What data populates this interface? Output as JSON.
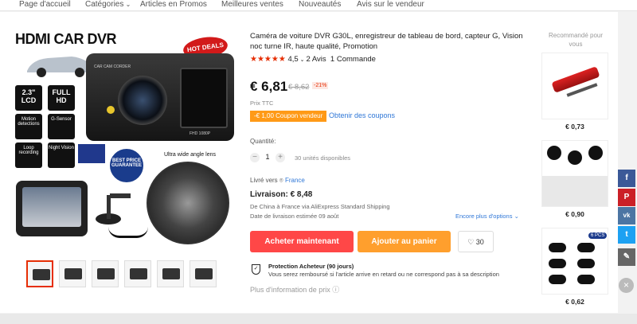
{
  "nav": {
    "items": [
      "Page d'accueil",
      "Catégories",
      "Articles en Promos",
      "Meilleures ventes",
      "Nouveautés",
      "Avis sur le vendeur"
    ],
    "categories_chevron": "chevron-down-icon"
  },
  "gallery": {
    "image_text": {
      "title": "HDMI CAR DVR",
      "hot_deals": "HOT DEALS",
      "lcd": "2.3\" LCD",
      "full_hd": "FULL HD",
      "motion": "Motion detections",
      "gsensor": "G-Sensor",
      "loop": "Loop recording",
      "night": "Night Vision",
      "best_price": "BEST PRICE GUARANTEE",
      "wide_angle": "Ultra wide angle lens",
      "fhd": "FHD 1080P",
      "corder": "CAR CAM CORDER"
    },
    "thumb_count": 6
  },
  "product": {
    "title": "Caméra de voiture DVR G30L, enregistreur de tableau de bord, capteur G, Vision noc turne IR, haute qualité, Promotion",
    "stars": "★★★★★",
    "rating": "4,5",
    "reviews": "2 Avis",
    "orders": "1 Commande",
    "price": "€ 6,81",
    "old_price": "€ 8,62",
    "discount": "-21%",
    "tax_note": "Prix TTC",
    "coupon": "-€ 1,00 Coupon vendeur",
    "coupon_link": "Obtenir des coupons",
    "quantity_label": "Quantité:",
    "quantity": "1",
    "minus": "−",
    "plus": "+",
    "availability": "30 unités disponibles",
    "ship_to_label": "Livré vers",
    "ship_to_country": "France",
    "shipping": "Livraison: € 8,48",
    "from": "De China à France via AliExpress Standard Shipping",
    "delivery_date": "Date de livraison estimée 09 août",
    "more_options": "Encore plus d'options",
    "buy_now": "Acheter maintenant",
    "add_to_cart": "Ajouter au panier",
    "wishlist_count": "30",
    "protection_title": "Protection Acheteur (90 jours)",
    "protection_text": "Vous serez remboursé si l'article arrive en retard ou ne correspond pas à sa description",
    "more_price_info": "Plus d'information de prix"
  },
  "recommended": {
    "title": "Recommandé pour vous",
    "items": [
      {
        "price": "€ 0,73",
        "kind": "red flashlight"
      },
      {
        "price": "€ 0,90",
        "kind": "phone holders"
      },
      {
        "price": "€ 0,62",
        "kind": "webcam covers",
        "badge": "6 PCS"
      }
    ]
  },
  "social": {
    "items": [
      {
        "icon": "facebook-icon",
        "glyph": "f",
        "color": "#3b5998"
      },
      {
        "icon": "pinterest-icon",
        "glyph": "P",
        "color": "#cb2027"
      },
      {
        "icon": "vk-icon",
        "glyph": "vk",
        "color": "#4c75a3"
      },
      {
        "icon": "twitter-icon",
        "glyph": "t",
        "color": "#1da1f2"
      },
      {
        "icon": "edit-icon",
        "glyph": "✎",
        "color": "#666666"
      }
    ],
    "close_glyph": "×"
  },
  "colors": {
    "accent": "#e62e04",
    "buy": "#ff4747",
    "cart": "#ff9f2d",
    "coupon": "#ff9a17",
    "link": "#2f77d7"
  }
}
